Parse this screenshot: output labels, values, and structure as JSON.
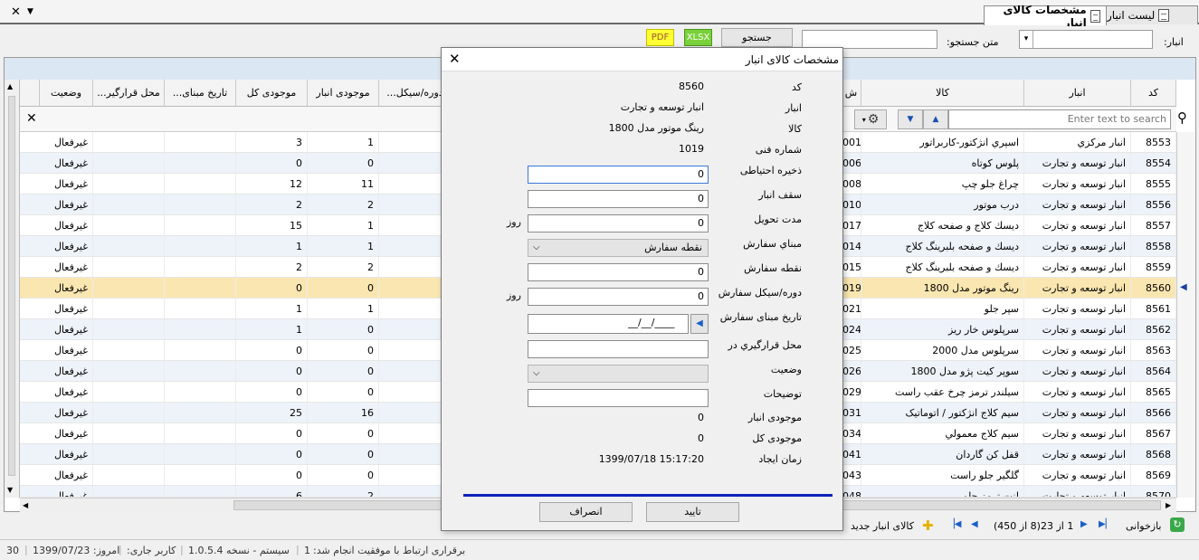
{
  "tabs": [
    {
      "label": "لیست انبار",
      "active": false
    },
    {
      "label": "مشخصات کالای انبار",
      "active": true
    }
  ],
  "toolbar": {
    "anbar_label": "انبار:",
    "search_text_label": "متن جستجو:",
    "search_button": "جستجو",
    "xlsx": "XLSX",
    "pdf": "PDF"
  },
  "grid": {
    "columns": [
      "کد",
      "انبار",
      "کالا",
      "ش",
      "دوره/سیکل...",
      "موجودی انبار",
      "موجودی کل",
      "تاریخ مبنای...",
      "محل قرارگیر...",
      "وضعیت"
    ],
    "search_placeholder": "Enter text to search",
    "rows": [
      {
        "code": "8553",
        "anbar": "انبار مرکزي",
        "kala": "اسپري انژکتور-کاربراتور",
        "sh": "001",
        "mojoodi_anbar": "1",
        "mojoodi_kol": "3",
        "status": "غیرفعال"
      },
      {
        "code": "8554",
        "anbar": "انبار توسعه و تجارت",
        "kala": "پلوس کوتاه",
        "sh": "006",
        "mojoodi_anbar": "0",
        "mojoodi_kol": "0",
        "status": "غیرفعال"
      },
      {
        "code": "8555",
        "anbar": "انبار توسعه و تجارت",
        "kala": "چراغ جلو چپ",
        "sh": "008",
        "mojoodi_anbar": "11",
        "mojoodi_kol": "12",
        "status": "غیرفعال"
      },
      {
        "code": "8556",
        "anbar": "انبار توسعه و تجارت",
        "kala": "درب موتور",
        "sh": "010",
        "mojoodi_anbar": "2",
        "mojoodi_kol": "2",
        "status": "غیرفعال"
      },
      {
        "code": "8557",
        "anbar": "انبار توسعه و تجارت",
        "kala": "ديسك كلاج و صفحه كلاج",
        "sh": "017",
        "mojoodi_anbar": "1",
        "mojoodi_kol": "15",
        "status": "غیرفعال"
      },
      {
        "code": "8558",
        "anbar": "انبار توسعه و تجارت",
        "kala": "ديسك و صفحه بلبرينگ كلاج",
        "sh": "014",
        "mojoodi_anbar": "1",
        "mojoodi_kol": "1",
        "status": "غیرفعال"
      },
      {
        "code": "8559",
        "anbar": "انبار توسعه و تجارت",
        "kala": "ديسك و صفحه بلبرينگ كلاج",
        "sh": "015",
        "mojoodi_anbar": "2",
        "mojoodi_kol": "2",
        "status": "غیرفعال"
      },
      {
        "code": "8560",
        "anbar": "انبار توسعه و تجارت",
        "kala": "رينگ موتور مدل 1800",
        "sh": "019",
        "mojoodi_anbar": "0",
        "mojoodi_kol": "0",
        "status": "غیرفعال"
      },
      {
        "code": "8561",
        "anbar": "انبار توسعه و تجارت",
        "kala": "سپر جلو",
        "sh": "021",
        "mojoodi_anbar": "1",
        "mojoodi_kol": "1",
        "status": "غیرفعال"
      },
      {
        "code": "8562",
        "anbar": "انبار توسعه و تجارت",
        "kala": "سرپلوس خار ريز",
        "sh": "024",
        "mojoodi_anbar": "0",
        "mojoodi_kol": "1",
        "status": "غیرفعال"
      },
      {
        "code": "8563",
        "anbar": "انبار توسعه و تجارت",
        "kala": "سرپلوس مدل 2000",
        "sh": "025",
        "mojoodi_anbar": "0",
        "mojoodi_kol": "0",
        "status": "غیرفعال"
      },
      {
        "code": "8564",
        "anbar": "انبار توسعه و تجارت",
        "kala": "سوپر كيت پژو مدل 1800",
        "sh": "026",
        "mojoodi_anbar": "0",
        "mojoodi_kol": "0",
        "status": "غیرفعال"
      },
      {
        "code": "8565",
        "anbar": "انبار توسعه و تجارت",
        "kala": "سيلندر ترمز چرخ عقب راست",
        "sh": "029",
        "mojoodi_anbar": "0",
        "mojoodi_kol": "0",
        "status": "غیرفعال"
      },
      {
        "code": "8566",
        "anbar": "انبار توسعه و تجارت",
        "kala": "سيم كلاج انژكتور / اتوماتيک",
        "sh": "031",
        "mojoodi_anbar": "16",
        "mojoodi_kol": "25",
        "status": "غیرفعال"
      },
      {
        "code": "8567",
        "anbar": "انبار توسعه و تجارت",
        "kala": "سيم كلاج معمولي",
        "sh": "034",
        "mojoodi_anbar": "0",
        "mojoodi_kol": "0",
        "status": "غیرفعال"
      },
      {
        "code": "8568",
        "anbar": "انبار توسعه و تجارت",
        "kala": "قفل كن گاردان",
        "sh": "041",
        "mojoodi_anbar": "0",
        "mojoodi_kol": "0",
        "status": "غیرفعال"
      },
      {
        "code": "8569",
        "anbar": "انبار توسعه و تجارت",
        "kala": "گلگير جلو راست",
        "sh": "043",
        "mojoodi_anbar": "0",
        "mojoodi_kol": "0",
        "status": "غیرفعال"
      },
      {
        "code": "8570",
        "anbar": "انبار توسعه و تجارت",
        "kala": "لنت ترمز جلو",
        "sh": "048",
        "mojoodi_anbar": "2",
        "mojoodi_kol": "6",
        "status": "غیرفعال"
      }
    ],
    "selected_code": "8560"
  },
  "pager": {
    "reload": "بازخوانی",
    "info": "1 از 23(8 از 450)",
    "new_item": "كالای انبار جديد"
  },
  "statusbar": {
    "connection": "برقراری ارتباط با موفقیت انجام شد:",
    "connection_count": "1",
    "system_version": "سیستم - نسخه 1.0.5.4",
    "current_user_label": "کاربر جاری:",
    "today": "امروز: 1399/07/23",
    "count": "30"
  },
  "dialog": {
    "title": "مشخصات کالای انبار",
    "labels": {
      "code": "کد",
      "anbar": "انبار",
      "kala": "کالا",
      "shomare_fani": "شماره فنی",
      "zakhire": "ذخیره احتیاطی",
      "saghf": "سقف انبار",
      "modat": "مدت تحویل",
      "mabna": "مبناي سفارش",
      "noghte": "نقطه سفارش",
      "doreh": "دوره/سیکل سفارش",
      "tarikh": "تاریخ مبنای سفارش",
      "mahal": "محل قرارگیري در",
      "vaziat": "وضعیت",
      "tozihat": "توضیحات",
      "mojoodi_anbar": "موجودی انبار",
      "mojoodi_kol": "موجودی کل",
      "zaman": "زمان ایجاد"
    },
    "values": {
      "code": "8560",
      "anbar": "انبار توسعه و تجارت",
      "kala": "رينگ موتور مدل 1800",
      "shomare_fani": "1019",
      "zakhire": "0",
      "saghf": "0",
      "modat": "0",
      "mabna": "نقطه سفارش",
      "noghte": "0",
      "doreh": "0",
      "tarikh": "__/__/____",
      "mahal": "",
      "vaziat": "",
      "tozihat": "",
      "mojoodi_anbar": "0",
      "mojoodi_kol": "0",
      "zaman": "15:17:20 1399/07/18"
    },
    "unit_day": "روز",
    "ok": "تایید",
    "cancel": "انصراف"
  }
}
